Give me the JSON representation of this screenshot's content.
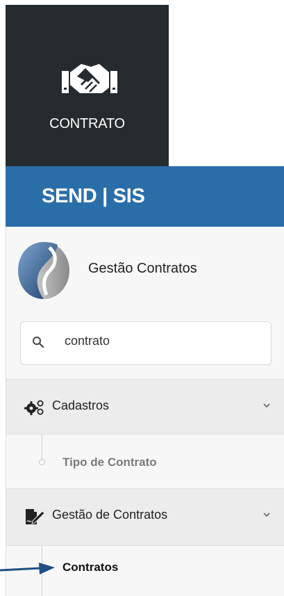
{
  "tile": {
    "label": "CONTRATO",
    "icon": "handshake-icon"
  },
  "header": {
    "brand": "SEND | SIS"
  },
  "profile": {
    "name": "Gestão Contratos",
    "logo_icon": "company-logo"
  },
  "search": {
    "value": "contrato",
    "icon": "search-icon"
  },
  "menu": {
    "cadastros": {
      "label": "Cadastros",
      "icon": "gears-icon",
      "items": [
        {
          "label": "Tipo de Contrato"
        }
      ]
    },
    "gestao": {
      "label": "Gestão de Contratos",
      "icon": "signed-document-icon",
      "items": [
        {
          "label": "Contratos",
          "active": true
        }
      ]
    }
  },
  "colors": {
    "tile_bg": "#252b2f",
    "header_bg": "#2a6ea9",
    "sidebar_bg": "#f7f7f7",
    "menu_head_bg": "#ececec",
    "arrow": "#1f4f84"
  }
}
